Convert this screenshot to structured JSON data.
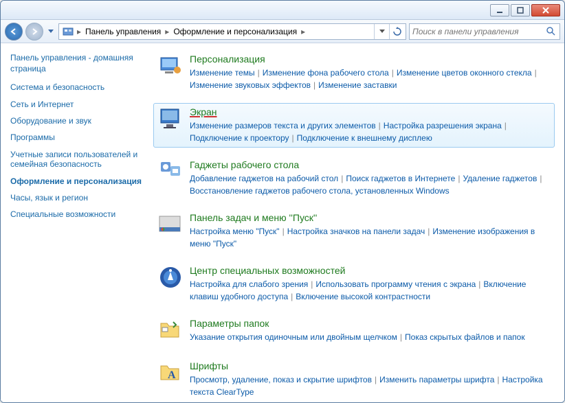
{
  "breadcrumb": {
    "root": "Панель управления",
    "sub": "Оформление и персонализация"
  },
  "search": {
    "placeholder": "Поиск в панели управления"
  },
  "sidebar": {
    "home": "Панель управления - домашняя страница",
    "items": [
      "Система и безопасность",
      "Сеть и Интернет",
      "Оборудование и звук",
      "Программы",
      "Учетные записи пользователей и семейная безопасность"
    ],
    "current": "Оформление и персонализация",
    "after": [
      "Часы, язык и регион",
      "Специальные возможности"
    ]
  },
  "categories": [
    {
      "title": "Персонализация",
      "icon": "personalization",
      "tasks": [
        "Изменение темы",
        "Изменение фона рабочего стола",
        "Изменение цветов оконного стекла",
        "Изменение звуковых эффектов",
        "Изменение заставки"
      ]
    },
    {
      "title": "Экран",
      "icon": "display",
      "selected": true,
      "underlined": true,
      "tasks": [
        "Изменение размеров текста и других элементов",
        "Настройка разрешения экрана",
        "Подключение к проектору",
        "Подключение к внешнему дисплею"
      ]
    },
    {
      "title": "Гаджеты рабочего стола",
      "icon": "gadgets",
      "tasks": [
        "Добавление гаджетов на рабочий стол",
        "Поиск гаджетов в Интернете",
        "Удаление гаджетов",
        "Восстановление гаджетов рабочего стола, установленных Windows"
      ]
    },
    {
      "title": "Панель задач и меню ''Пуск''",
      "icon": "taskbar",
      "tasks": [
        "Настройка меню \"Пуск\"",
        "Настройка значков на панели задач",
        "Изменение изображения в меню \"Пуск\""
      ]
    },
    {
      "title": "Центр специальных возможностей",
      "icon": "ease",
      "tasks": [
        "Настройка для слабого зрения",
        "Использовать программу чтения с экрана",
        "Включение клавиш удобного доступа",
        "Включение высокой контрастности"
      ]
    },
    {
      "title": "Параметры папок",
      "icon": "folder",
      "tasks": [
        "Указание открытия одиночным или двойным щелчком",
        "Показ скрытых файлов и папок"
      ]
    },
    {
      "title": "Шрифты",
      "icon": "fonts",
      "tasks": [
        "Просмотр, удаление, показ и скрытие шрифтов",
        "Изменить параметры шрифта",
        "Настройка текста ClearType"
      ]
    }
  ]
}
